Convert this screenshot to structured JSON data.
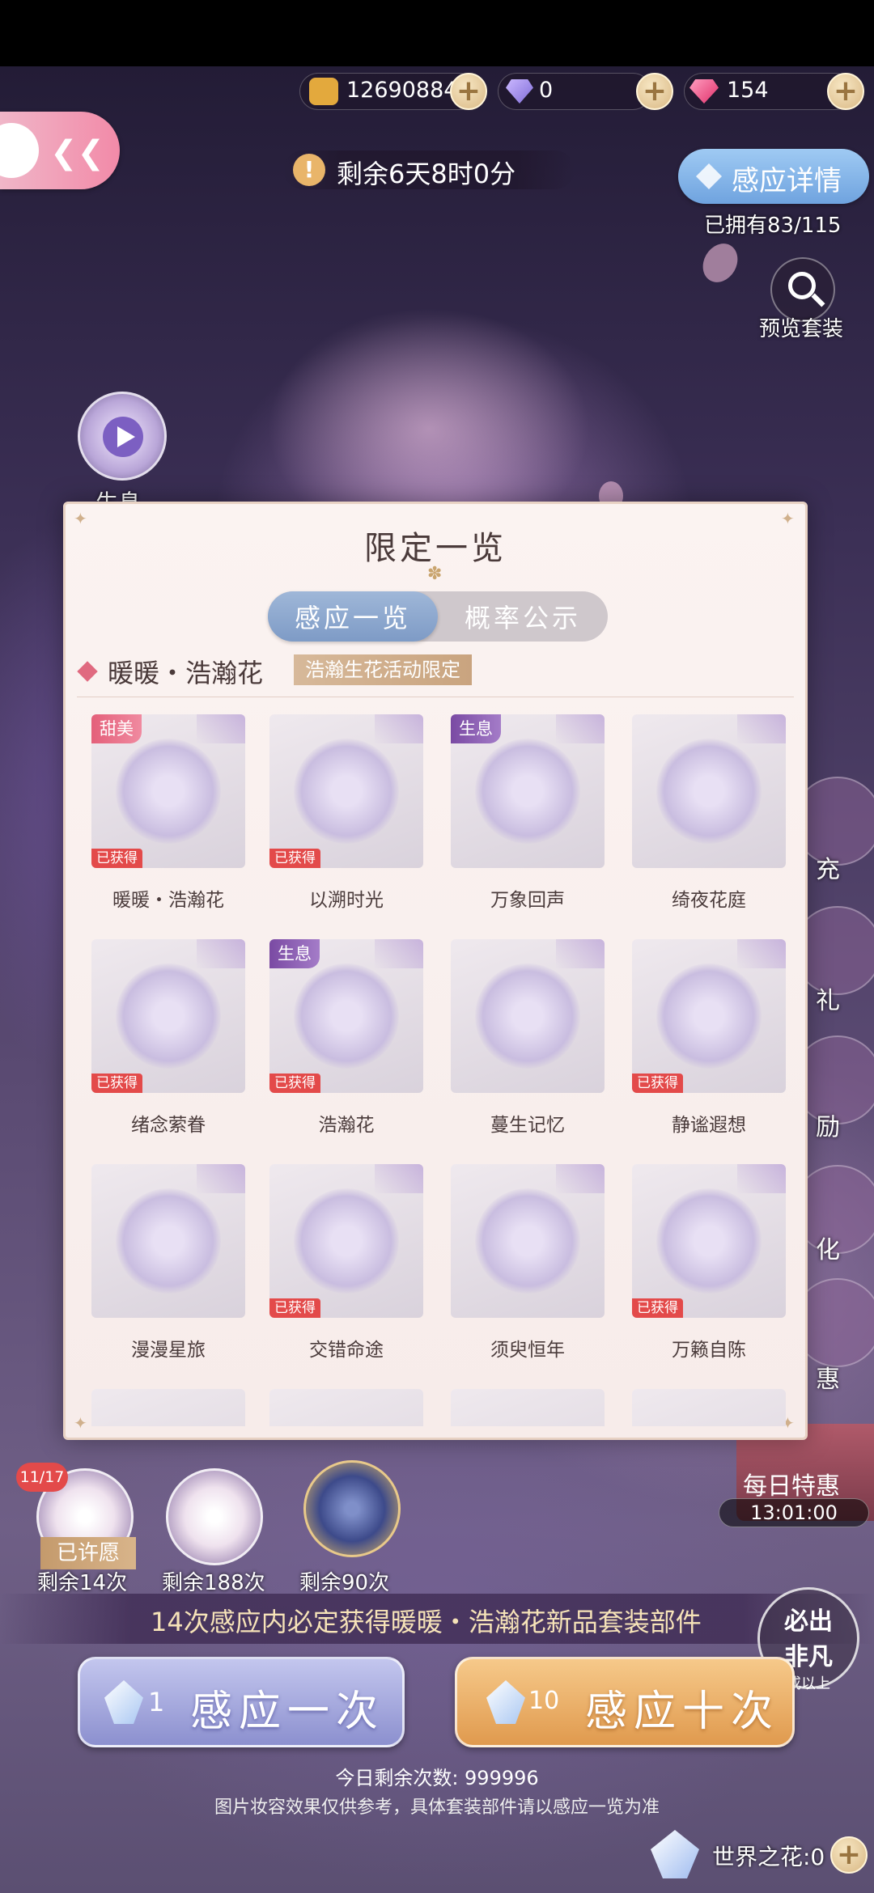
{
  "top": {
    "gold": "12690884",
    "diamond": "0",
    "gem": "154",
    "timer": "剩余6天8时0分",
    "detail_btn": "感应详情",
    "owned": "已拥有83/115",
    "preview": "预览套装"
  },
  "left": {
    "play_label": "生息"
  },
  "panel": {
    "title": "限定一览",
    "tabs": [
      "感应一览",
      "概率公示"
    ],
    "set_name": "暖暖・浩瀚花",
    "set_tag": "浩瀚生花活动限定",
    "obtained": "已获得",
    "items": [
      {
        "name": "暖暖・浩瀚花",
        "tag": "甜美",
        "obtained": true
      },
      {
        "name": "以溯时光",
        "tag": "",
        "obtained": true
      },
      {
        "name": "万象回声",
        "tag": "生息",
        "obtained": false
      },
      {
        "name": "绮夜花庭",
        "tag": "",
        "obtained": false
      },
      {
        "name": "绪念萦眷",
        "tag": "",
        "obtained": true
      },
      {
        "name": "浩瀚花",
        "tag": "生息",
        "obtained": true
      },
      {
        "name": "蔓生记忆",
        "tag": "",
        "obtained": false
      },
      {
        "name": "静谧遐想",
        "tag": "",
        "obtained": true
      },
      {
        "name": "漫漫星旅",
        "tag": "",
        "obtained": false
      },
      {
        "name": "交错命途",
        "tag": "",
        "obtained": true
      },
      {
        "name": "须臾恒年",
        "tag": "",
        "obtained": false
      },
      {
        "name": "万籁自陈",
        "tag": "",
        "obtained": true
      }
    ]
  },
  "right_side": [
    "充",
    "礼",
    "励",
    "化",
    "惠"
  ],
  "daily": {
    "label": "每日特惠",
    "time": "13:01:00"
  },
  "wishes": [
    {
      "count": "11/17",
      "status": "已许愿",
      "remain": "剩余14次"
    },
    {
      "count": "",
      "status": "",
      "remain": "剩余188次"
    },
    {
      "count": "",
      "status": "",
      "remain": "剩余90次"
    }
  ],
  "guarantee": "14次感应内必定获得暖暖・浩瀚花新品套装部件",
  "stamp": {
    "line1": "必出",
    "line2": "非凡",
    "line3": "或以上"
  },
  "buttons": {
    "once_num": "1",
    "once": "感应一次",
    "ten_num": "10",
    "ten": "感应十次"
  },
  "today": "今日剩余次数: 999996",
  "disclaimer": "图片妆容效果仅供参考，具体套装部件请以感应一览为准",
  "world_flower": "世界之花:0"
}
